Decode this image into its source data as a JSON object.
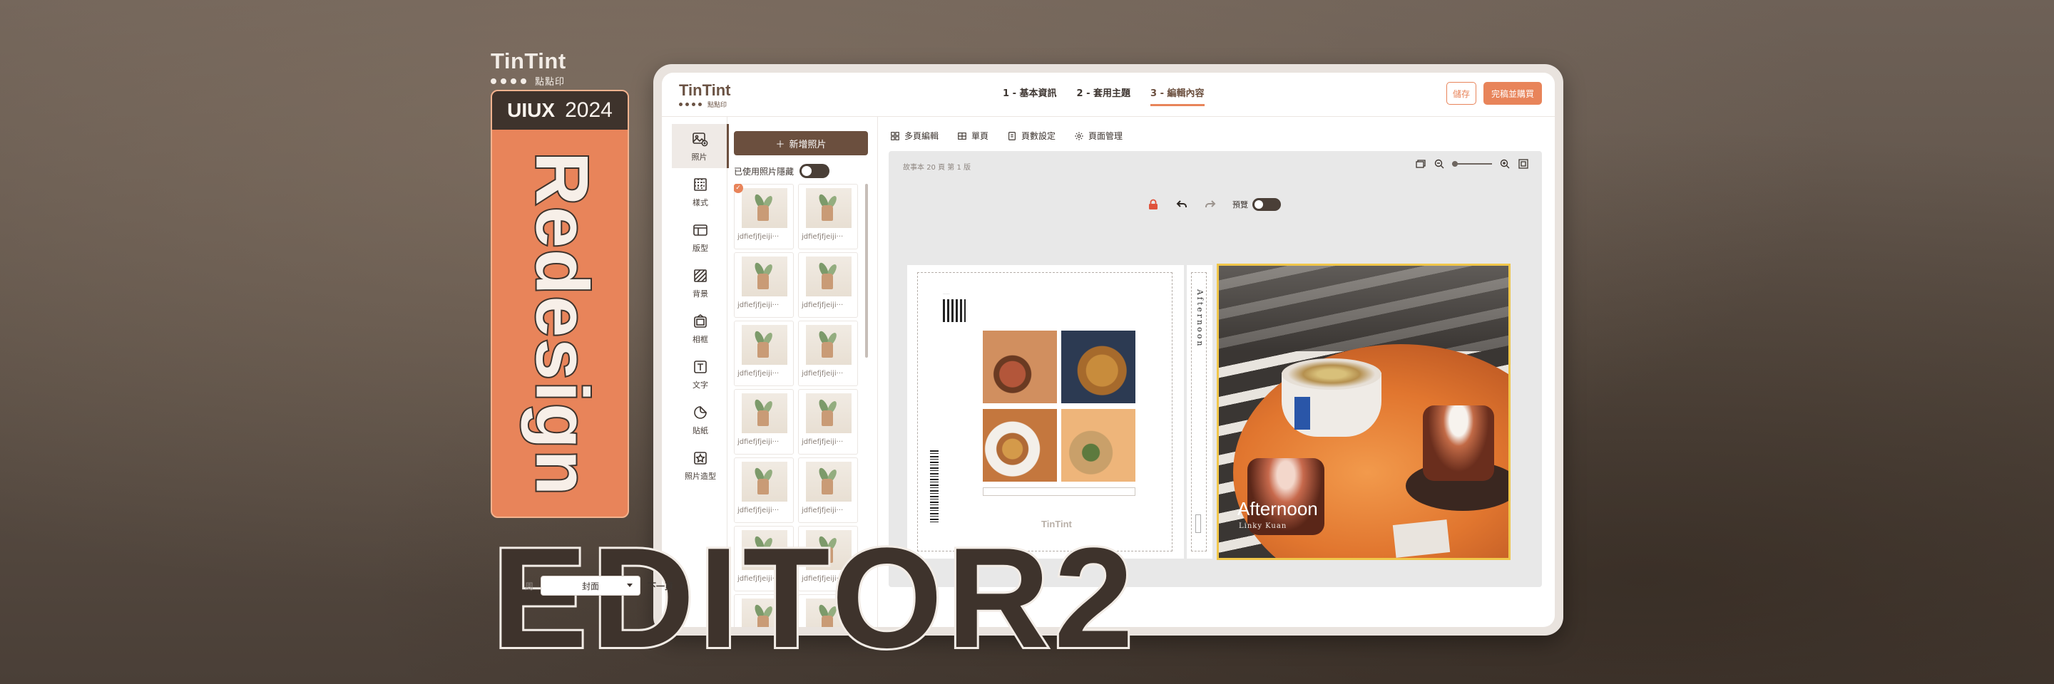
{
  "brand": {
    "name": "TinTint",
    "sub_label": "點點印"
  },
  "poster": {
    "uiux": "UIUX",
    "year": "2024",
    "vertical_title": "Redesign",
    "big_title": "EDITOR2"
  },
  "app": {
    "logo_name": "TinTint",
    "logo_sub": "點點印",
    "steps": [
      "1 - 基本資訊",
      "2 - 套用主題",
      "3 - 編輯內容"
    ],
    "active_step": 2,
    "save_label": "儲存",
    "finish_label": "完稿並購買"
  },
  "tools": [
    {
      "label": "照片",
      "icon": "photo-icon",
      "active": true
    },
    {
      "label": "樣式",
      "icon": "pattern-icon"
    },
    {
      "label": "版型",
      "icon": "layout-icon"
    },
    {
      "label": "背景",
      "icon": "background-icon"
    },
    {
      "label": "相框",
      "icon": "frame-icon"
    },
    {
      "label": "文字",
      "icon": "text-icon"
    },
    {
      "label": "貼紙",
      "icon": "sticker-icon"
    },
    {
      "label": "照片造型",
      "icon": "shape-icon"
    }
  ],
  "photo_panel": {
    "add_label": "新增照片",
    "hide_used_label": "已使用照片隱藏",
    "thumb_caption": "jdfiefjfjeiji···"
  },
  "canvas": {
    "toolbar": [
      "多頁編輯",
      "單頁",
      "頁數設定",
      "頁面管理"
    ],
    "book_label": "故事本",
    "page_count": "20 頁 第 1 版",
    "preview_label": "預覽",
    "spine_text": "Afternoon",
    "cover_title": "Afternoon",
    "cover_author": "Linky Kuan",
    "pager": {
      "prev_label": "周",
      "selected_page": "封面",
      "next_label": "下一頁"
    }
  },
  "colors": {
    "accent": "#e8845a",
    "brown": "#6b4f3e",
    "dark": "#3e332c",
    "highlight": "#f0c64a"
  }
}
